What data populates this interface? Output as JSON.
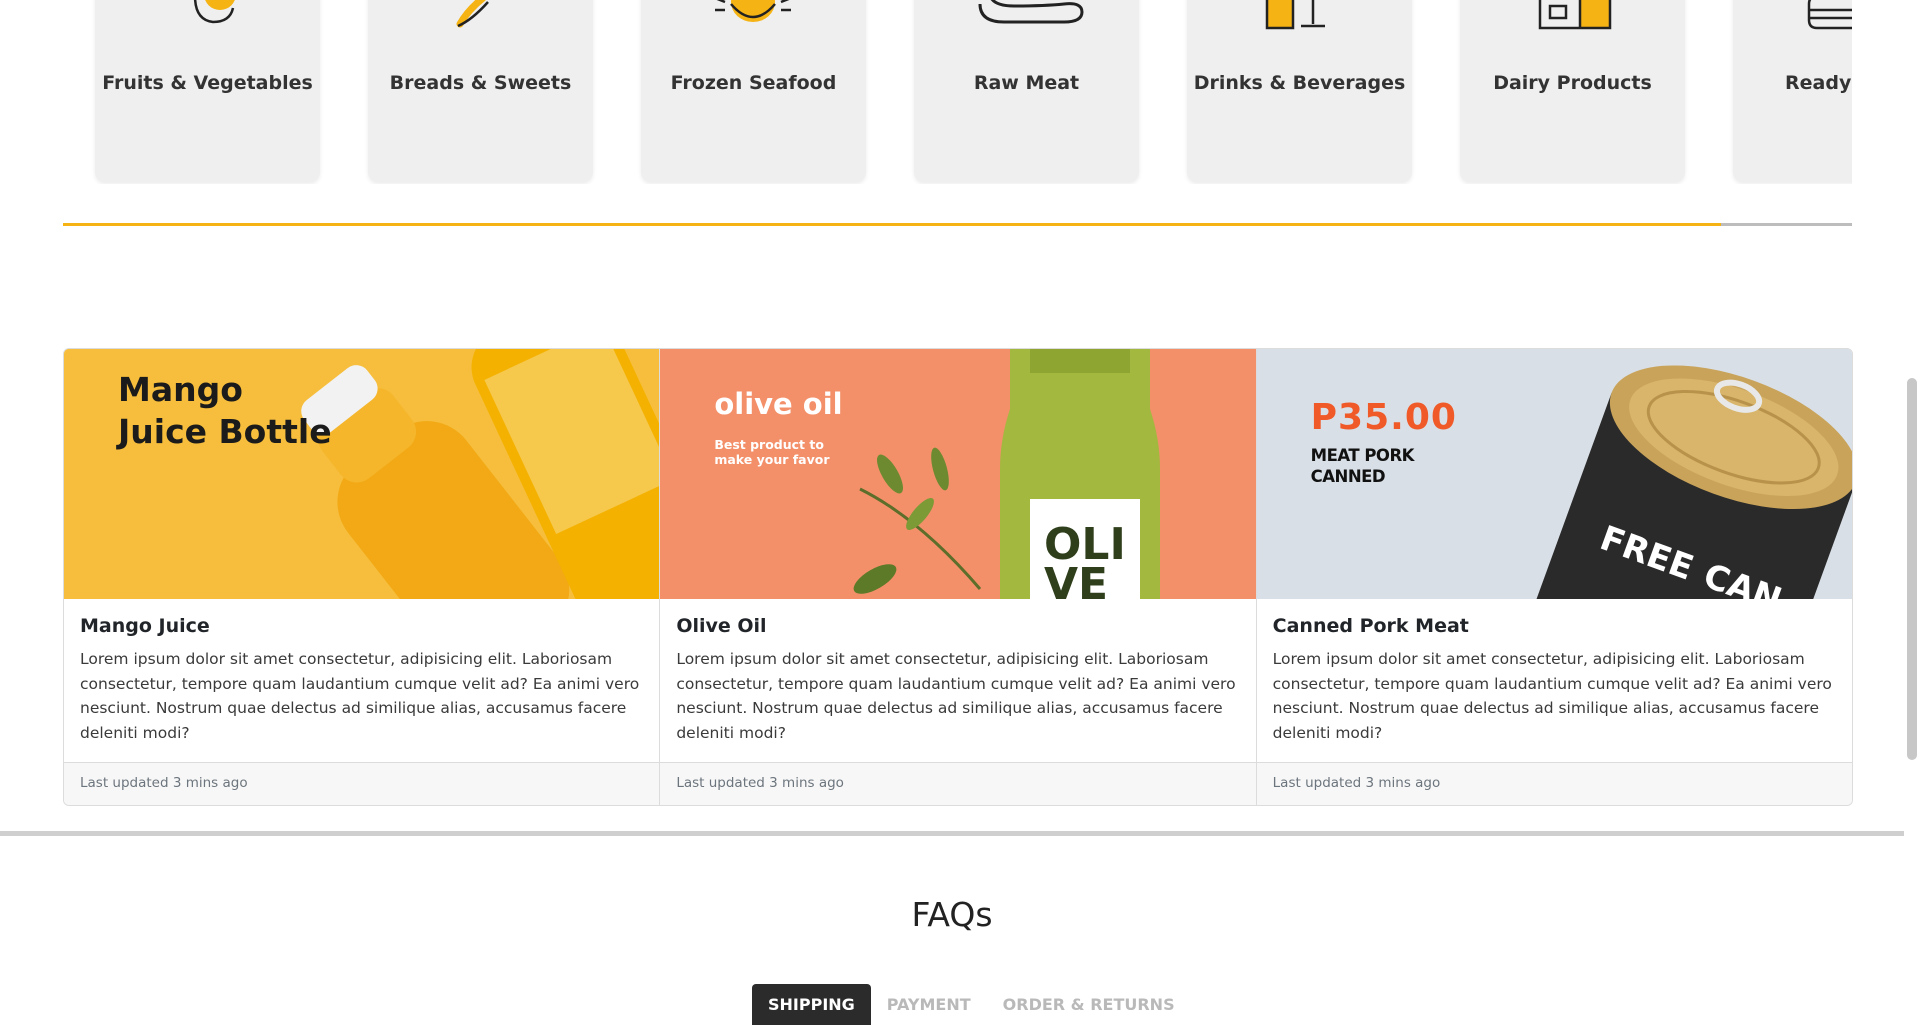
{
  "categories": {
    "items": [
      {
        "label": "Fruits & Vegetables",
        "icon": "fruit-icon"
      },
      {
        "label": "Breads & Sweets",
        "icon": "bread-icon"
      },
      {
        "label": "Frozen Seafood",
        "icon": "crab-icon"
      },
      {
        "label": "Raw Meat",
        "icon": "meat-icon"
      },
      {
        "label": "Drinks & Beverages",
        "icon": "drinks-icon"
      },
      {
        "label": "Dairy Products",
        "icon": "milk-carton-icon"
      },
      {
        "label": "Ready Meals",
        "icon": "ready-meal-icon"
      }
    ],
    "scroll_progress": 0.927,
    "accent_color": "#f5b314"
  },
  "products": [
    {
      "banner_title": "Mango Juice Bottle",
      "title": "Mango Juice",
      "text": "Lorem ipsum dolor sit amet consectetur, adipisicing elit. Laboriosam consectetur, tempore quam laudantium cumque velit ad? Ea animi vero nesciunt. Nostrum quae delectus ad similique alias, accusamus facere deleniti modi?",
      "footer": "Last updated 3 mins ago",
      "banner_bg": "#f6be3c"
    },
    {
      "banner_title": "olive oil",
      "banner_sub": "Best product to make your favor",
      "title": "Olive Oil",
      "text": "Lorem ipsum dolor sit amet consectetur, adipisicing elit. Laboriosam consectetur, tempore quam laudantium cumque velit ad? Ea animi vero nesciunt. Nostrum quae delectus ad similique alias, accusamus facere deleniti modi?",
      "footer": "Last updated 3 mins ago",
      "banner_bg": "#f3906a"
    },
    {
      "banner_price": "P35.00",
      "banner_name": "MEAT PORK CANNED",
      "title": "Canned Pork Meat",
      "text": "Lorem ipsum dolor sit amet consectetur, adipisicing elit. Laboriosam consectetur, tempore quam laudantium cumque velit ad? Ea animi vero nesciunt. Nostrum quae delectus ad similique alias, accusamus facere deleniti modi?",
      "footer": "Last updated 3 mins ago",
      "banner_bg": "#d8dfe6"
    }
  ],
  "faq": {
    "title": "FAQs",
    "tabs": [
      "SHIPPING",
      "PAYMENT",
      "ORDER & RETURNS"
    ],
    "active_tab": "SHIPPING"
  }
}
